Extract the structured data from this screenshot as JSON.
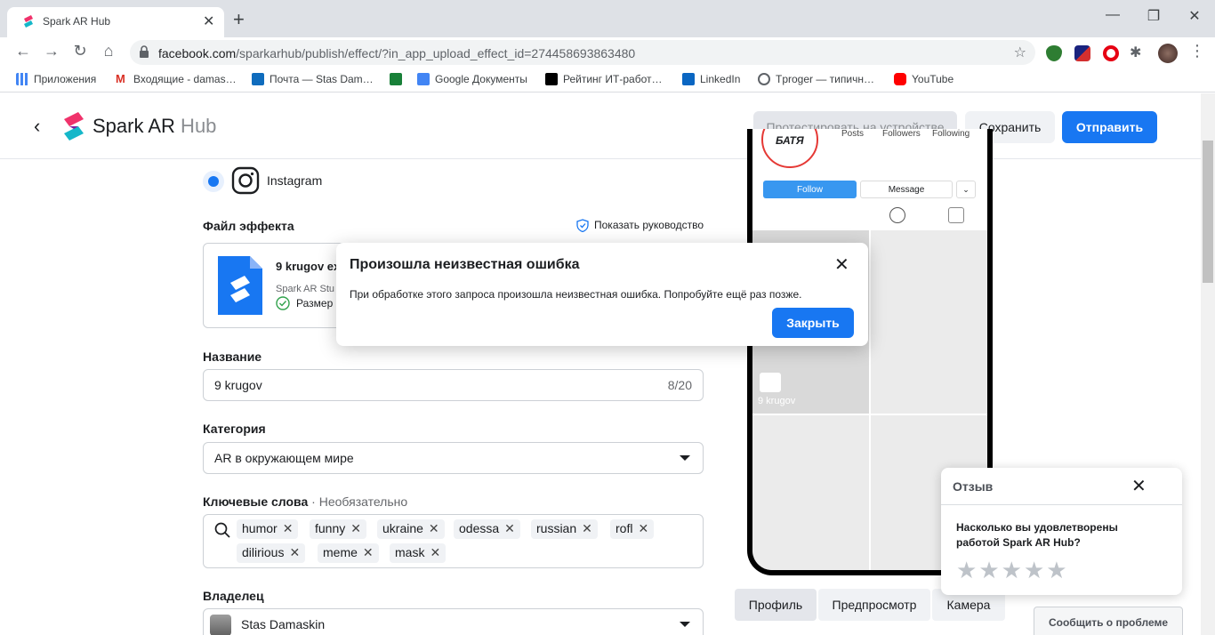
{
  "browser": {
    "tab_title": "Spark AR Hub",
    "tab_close": "✕",
    "new_tab": "+",
    "url_host": "facebook.com",
    "url_path": "/sparkarhub/publish/effect/?in_app_upload_effect_id=274458693863480",
    "bookmarks": [
      {
        "label": "Приложения",
        "color": "#4285f4"
      },
      {
        "label": "Входящие - damas…",
        "color": "#d93025"
      },
      {
        "label": "Почта — Stas Dam…",
        "color": "#0f6cbd"
      },
      {
        "label": "",
        "color": "#188038"
      },
      {
        "label": "Google Документы",
        "color": "#4285f4"
      },
      {
        "label": "Рейтинг ИТ-работ…",
        "color": "#000000"
      },
      {
        "label": "LinkedIn",
        "color": "#0a66c2"
      },
      {
        "label": "Tproger — типичн…",
        "color": "#3c4043"
      },
      {
        "label": "YouTube",
        "color": "#ff0000"
      }
    ]
  },
  "header": {
    "brand_main": "Spark AR",
    "brand_sub": " Hub",
    "test_label": "Протестировать на устройстве",
    "save_label": "Сохранить",
    "send_label": "Отправить"
  },
  "form": {
    "platform_label": "Instagram",
    "effect_file_label": "Файл эффекта",
    "guide_link": "Показать руководство",
    "file_name": "9 krugov ex",
    "file_source": "Spark AR Stu",
    "file_size": "Размер",
    "name_label": "Название",
    "name_value": "9 krugov",
    "name_counter": "8/20",
    "category_label": "Категория",
    "category_value": "AR в окружающем мире",
    "keywords_label": "Ключевые слова",
    "keywords_optional": " · Необязательно",
    "keywords": [
      "humor",
      "funny",
      "ukraine",
      "odessa",
      "russian",
      "rofl",
      "dilirious",
      "meme",
      "mask"
    ],
    "owner_label": "Владелец",
    "owner_value": "Stas Damaskin"
  },
  "preview": {
    "stat_posts": "Posts",
    "stat_followers": "Followers",
    "stat_following": "Following",
    "logo_text": "БАТЯ",
    "follow": "Follow",
    "message": "Message",
    "effect_tile_label": "9 krugov",
    "tabs": [
      "Профиль",
      "Предпросмотр",
      "Камера"
    ]
  },
  "feedback": {
    "title": "Отзыв",
    "question": "Насколько вы удовлетворены работой Spark AR Hub?",
    "stars": 5
  },
  "report_label": "Сообщить о проблеме",
  "modal": {
    "title": "Произошла неизвестная ошибка",
    "text": "При обработке этого запроса произошла неизвестная ошибка. Попробуйте ещё раз позже.",
    "close_button": "Закрыть"
  },
  "colors": {
    "accent": "#1877f2"
  }
}
